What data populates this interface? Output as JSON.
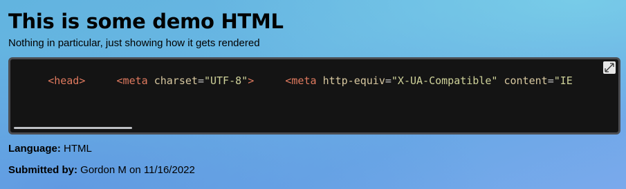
{
  "header": {
    "title": "This is some demo HTML",
    "subtitle": "Nothing in particular, just showing how it gets rendered"
  },
  "code_block": {
    "tokens": [
      {
        "type": "indent",
        "text": "      "
      },
      {
        "type": "tag",
        "text": "<head>"
      },
      {
        "type": "indent",
        "text": "     "
      },
      {
        "type": "tag",
        "text": "<meta "
      },
      {
        "type": "attr",
        "text": "charset"
      },
      {
        "type": "punct",
        "text": "="
      },
      {
        "type": "str",
        "text": "\"UTF-8\""
      },
      {
        "type": "tag",
        "text": ">"
      },
      {
        "type": "indent",
        "text": "     "
      },
      {
        "type": "tag",
        "text": "<meta "
      },
      {
        "type": "attr",
        "text": "http-equiv"
      },
      {
        "type": "punct",
        "text": "="
      },
      {
        "type": "str",
        "text": "\"X-UA-Compatible\""
      },
      {
        "type": "indent",
        "text": " "
      },
      {
        "type": "attr",
        "text": "content"
      },
      {
        "type": "punct",
        "text": "="
      },
      {
        "type": "str",
        "text": "\"IE"
      }
    ],
    "expand_icon": "expand-icon",
    "colors": {
      "background": "#141414",
      "tag": "#e07a5f",
      "attribute": "#d8c8a0",
      "string": "#cfd29a"
    }
  },
  "details": {
    "language_label": "Language:",
    "language_value": "HTML",
    "submitted_label": "Submitted by:",
    "submitted_value": "Gordon M on 11/16/2022"
  }
}
